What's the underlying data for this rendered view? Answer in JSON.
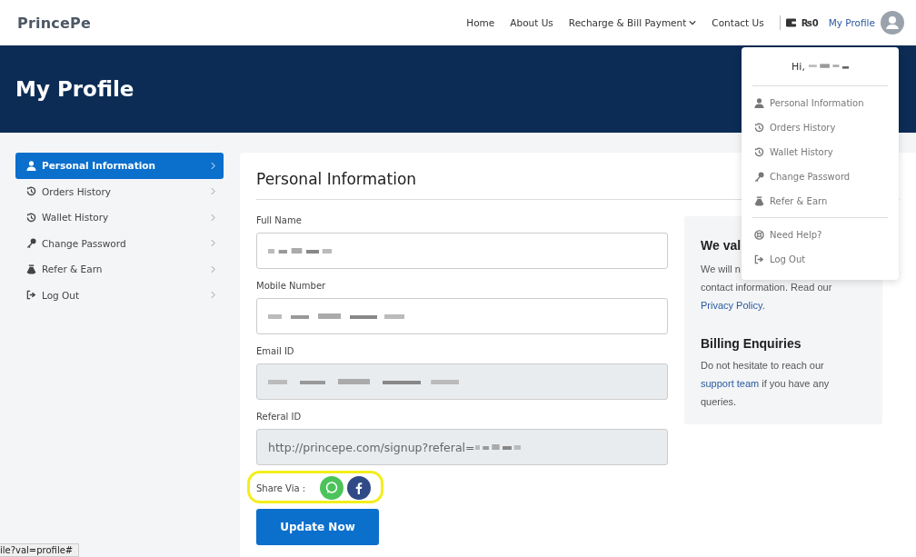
{
  "header": {
    "logo": "PrincePe",
    "nav": [
      {
        "label": "Home",
        "kind": "link"
      },
      {
        "label": "About Us",
        "kind": "link"
      },
      {
        "label": "Recharge & Bill Payment",
        "kind": "dropdown"
      },
      {
        "label": "Contact Us",
        "kind": "link"
      }
    ],
    "currency": "₨",
    "wallet": "0",
    "profile_label": "My Profile"
  },
  "banner": {
    "title": "My Profile"
  },
  "sidebar": {
    "items": [
      {
        "label": "Personal Information",
        "selected": true
      },
      {
        "label": "Orders History",
        "selected": false
      },
      {
        "label": "Wallet History",
        "selected": false
      },
      {
        "label": "Change Password",
        "selected": false
      },
      {
        "label": "Refer & Earn",
        "selected": false
      },
      {
        "label": "Log Out",
        "selected": false
      }
    ]
  },
  "form": {
    "title": "Personal Information",
    "fields": [
      {
        "label": "Full Name",
        "readonly": false
      },
      {
        "label": "Mobile Number",
        "readonly": false
      },
      {
        "label": "Email ID",
        "readonly": true
      },
      {
        "label": "Referal ID",
        "readonly": true,
        "value": "http://princepe.com/signup?referal="
      }
    ],
    "share_label": "Share Via :",
    "submit": "Update Now"
  },
  "aside": {
    "heading_1": "We val",
    "link_1": "Privacy Policy",
    "text_1b": "contact information. Read our",
    "text_1a": "We will n",
    "text_1c": ".",
    "heading_2": "Billing Enquiries",
    "text_2a": "Do not hesitate to reach our",
    "link_2": "support team",
    "text_2b": "if you have any queries."
  },
  "dropdown": {
    "greeting": "Hi,",
    "groups": [
      [
        "Personal Information",
        "Orders History",
        "Wallet History",
        "Change Password",
        "Refer & Earn"
      ],
      [
        "Need Help?",
        "Log Out"
      ]
    ]
  },
  "status_bar": "ile?val=profile#"
}
